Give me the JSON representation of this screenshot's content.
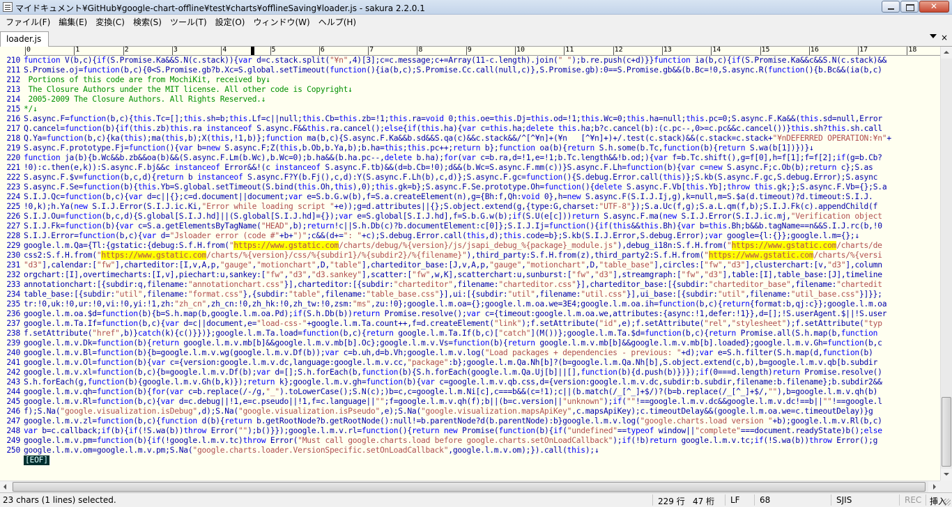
{
  "window": {
    "title": "マイドキュメント¥GitHub¥google-chart-offline¥test¥charts¥offlineSaving¥loader.js - sakura 2.2.0.1"
  },
  "menu": [
    "ファイル(F)",
    "編集(E)",
    "変換(C)",
    "検索(S)",
    "ツール(T)",
    "設定(O)",
    "ウィンドウ(W)",
    "ヘルプ(H)"
  ],
  "tab": {
    "label": "loader.js",
    "close": "×"
  },
  "ruler": [
    "0",
    "1",
    "2",
    "3",
    "4",
    "5",
    "6",
    "7",
    "8",
    "9",
    "10",
    "11",
    "12",
    "13",
    "14",
    "15",
    "16",
    "17",
    "18"
  ],
  "lines": [
    {
      "n": "210",
      "t": "function V(b,c){if(S.Promise.Ka&&S.N(c.stack)){var d=c.stack.split(\"¥n\",4)[3];c=c.message;c+=Array(11-c.length).join(\" \");b.re.push(c+d)}}function ia(b,c){if(S.Promise.Ka&&c&&S.N(c.stack)&&"
    },
    {
      "n": "211",
      "t": "S.Promise.oj=function(b,c){0<S.Promise.gb?b.Xc=S.global.setTimeout(function(){ia(b,c);S.Promise.Cc.call(null,c)},S.Promise.gb):0==S.Promise.gb&&(b.Bc=!0,S.async.R(function(){b.Bc&&(ia(b,c)"
    },
    {
      "n": "212",
      "t": " Portions of this code are from MochiKit, received by↓",
      "c": "cm"
    },
    {
      "n": "213",
      "t": " The Closure Authors under the MIT license. All other code is Copyright↓",
      "c": "cm"
    },
    {
      "n": "214",
      "t": " 2005-2009 The Closure Authors. All Rights Reserved.↓",
      "c": "cm"
    },
    {
      "n": "215",
      "t": "*/↓",
      "c": "cm"
    },
    {
      "n": "216",
      "t": "S.async.F=function(b,c){this.Tc=[];this.sh=b;this.Lf=c||null;this.Cb=this.zb=!1;this.ra=void 0;this.oe=this.Dj=this.od=!1;this.Wc=0;this.ha=null;this.pc=0;S.async.F.Ka&&(this.sd=null,Error"
    },
    {
      "n": "217",
      "t": "Q.cancel=function(b){if(this.zb)this.ra instanceof S.async.F&&this.ra.cancel();else{if(this.ha){var c=this.ha;delete this.ha;b?c.cancel(b):(c.pc--,0>=c.pc&&c.cancel())}this.sh?this.sh.call"
    },
    {
      "n": "218",
      "t": "Q.Ya=function(b,c){ka(this);ma(this,b);X(this,!1,b)};function ma(b,c){S.async.F.Ka&&b.sd&&S.qa(c)&&c.stack&&/^[^¥n]+(¥n   [^¥n]+)+/.test(c.stack)&&(c.stack=c.stack+\"¥nDEFERRED OPERATION:¥n\"+"
    },
    {
      "n": "219",
      "t": "S.async.F.prototype.Fj=function(){var b=new S.async.F;Z(this,b.Ob,b.Ya,b);b.ha=this;this.pc++;return b};function oa(b){return S.h.some(b.Tc,function(b){return S.wa(b[1])})}↓"
    },
    {
      "n": "220",
      "t": "function ja(b){b.Wc&&b.zb&&oa(b)&&(S.async.F.Lm(b.Wc),b.Wc=0);b.ha&&(b.ha.pc--,delete b.ha);for(var c=b.ra,d=!1,e=!1;b.Tc.length&&!b.od;){var f=b.Tc.shift(),g=f[0],h=f[1];f=f[2];if(g=b.Cb?"
    },
    {
      "n": "221",
      "t": "!0):c.then(e,k)):S.async.F.bj&&c instanceof Error&&!(c instanceof S.async.F.tb)&&(d=b.Cb=!0);d&&(b.Wc=S.async.F.mm(c))}S.async.F.Lh=function(b){var c=new S.async.F;c.Ob(b);return c};S.as"
    },
    {
      "n": "222",
      "t": "S.async.F.$v=function(b,c,d){return b instanceof S.async.F?Y(b.Fj(),c,d):Y(S.async.F.Lh(b),c,d)};S.async.F.gc=function(){S.debug.Error.call(this)};S.kb(S.async.F.gc,S.debug.Error);S.async"
    },
    {
      "n": "223",
      "t": "S.async.F.Se=function(b){this.Yb=S.global.setTimeout(S.bind(this.Oh,this),0);this.gk=b};S.async.F.Se.prototype.Oh=function(){delete S.async.F.Vb[this.Yb];throw this.gk;};S.async.F.Vb={};S.a"
    },
    {
      "n": "224",
      "t": "S.I.J.Qc=function(b,c){var d=c||{};c=d.document||document;var e=S.b.G.w(b),f=S.a.createElement(n),g={Bh:f,Qh:void 0},h=new S.async.F(S.I.J.Ij,g),k=null,m=S.$a(d.timeout)?d.timeout:S.I.J."
    },
    {
      "n": "225",
      "t": "!0,k);h.Ya(new S.I.J.Error(S.I.J.ic.Ki,\"Error while loading script \"+e));g=d.attributes||{};S.object.extend(g,{type:G,charset:\"UTF-8\"});S.a.Uc(f,g);S.a.L.qm(f,b);S.I.J.Fk(c).appendChild(f"
    },
    {
      "n": "226",
      "t": "S.I.J.Ou=function(b,c,d){S.global[S.I.J.hd]||(S.global[S.I.J.hd]={});var e=S.global[S.I.J.hd],f=S.b.G.w(b);if(S.U(e[c]))return S.async.F.ma(new S.I.J.Error(S.I.J.ic.mj,\"Verification object"
    },
    {
      "n": "227",
      "t": "S.I.J.Fk=function(b){var c=S.a.getElementsByTagName(\"HEAD\",b);return!c||S.h.Db(c)?b.documentElement:c[0]};S.I.J.Ij=function(){if(this&&this.Bh){var b=this.Bh;b&&b.tagName==n&&S.I.J.rc(b,!0"
    },
    {
      "n": "228",
      "t": "S.I.J.Error=function(b,c){var d=\"Jsloader error (code #\"+b+\")\";c&&(d+=\": \"+c);S.debug.Error.call(this,d);this.code=b};S.kb(S.I.J.Error,S.debug.Error);var google={l:{}};google.l.m={};↓"
    },
    {
      "n": "229",
      "t": "google.l.m.Qa={Tl:{gstatic:{debug:S.f.H.from(\"https://www.gstatic.com/charts/debug/%{version}/js/jsapi_debug_%{package}_module.js\"),debug_i18n:S.f.H.from(\"https://www.gstatic.com/charts/de"
    },
    {
      "n": "230",
      "t": "css2:S.f.H.from(\"https://www.gstatic.com/charts/%{version}/css/%{subdir1}/%{subdir2}/%{filename}\"),third_party:S.f.H.from(z),third_party2:S.f.H.from(\"https://www.gstatic.com/charts/%{versi"
    },
    {
      "n": "231",
      "t": "\"d3\"],calendar:[\"fw\"],charteditor:[I,v,A,p,\"gauge\",\"motionchart\",D,\"table\"],charteditor_base:[J,v,A,p,\"gauge\",\"motionchart\",D,\"table_base\"],circles:[\"fw\",\"d3\"],clusterchart:[v,\"d3\"],column"
    },
    {
      "n": "232",
      "t": "orgchart:[I],overtimecharts:[I,v],piechart:u,sankey:[\"fw\",\"d3\",\"d3.sankey\"],scatter:[\"fw\",w,K],scatterchart:u,sunburst:[\"fw\",\"d3\"],streamgraph:[\"fw\",\"d3\"],table:[I],table_base:[J],timeline"
    },
    {
      "n": "233",
      "t": "annotationchart:[{subdir:q,filename:\"annotationchart.css\"}],charteditor:[{subdir:\"charteditor\",filename:\"charteditor.css\"}],charteditor_base:[{subdir:\"charteditor_base\",filename:\"chartedit"
    },
    {
      "n": "234",
      "t": "table_base:[{subdir:\"util\",filename:\"format.css\"},{subdir:\"table\",filename:\"table_base.css\"}],ui:[{subdir:\"util\",filename:\"util.css\"}],ui_base:[{subdir:\"util\",filename:\"util_base.css\"}]}};"
    },
    {
      "n": "235",
      "t": "tr:!0,uk:!0,ur:!0,vi:!0,yi:!1,zh:\"zh_cn\",zh_cn:!0,zh_hk:!0,zh_tw:!0,zsm:\"ms\",zu:!0};google.l.m.oa={};google.l.m.oa.we=3E4;google.l.m.oa.ih=function(b,c){return{format:b,qj:c}};google.l.m.oa"
    },
    {
      "n": "236",
      "t": "google.l.m.oa.$d=function(b){b=S.h.map(b,google.l.m.oa.Pd);if(S.h.Db(b))return Promise.resolve();var c={timeout:google.l.m.oa.we,attributes:{async:!1,defer:!1}},d=[];!S.userAgent.$||!S.user"
    },
    {
      "n": "237",
      "t": "google.l.m.Ta.If=function(b,c){var d=c||document,e=\"load-css-\"+google.l.m.Ta.count++,f=d.createElement(\"link\");f.setAttribute(\"id\",e);f.setAttribute(\"rel\",\"stylesheet\");f.setAttribute(\"typ"
    },
    {
      "n": "238",
      "t": "f.setAttribute(\"href\",b)}catch(k){c()}})};google.l.m.Ta.load=function(b,c){return google.l.m.Ta.If(b,c)[\"catch\"](M())};google.l.m.Ta.$d=function(b,c){return Promise.all(S.h.map(b,function"
    },
    {
      "n": "239",
      "t": "google.l.m.v.Dk=function(b){return google.l.m.v.mb[b]&&google.l.m.v.mb[b].Oc};google.l.m.v.Vs=function(b){return google.l.m.v.mb[b]&&google.l.m.v.mb[b].loaded};google.l.m.v.Gh=function(b,c"
    },
    {
      "n": "240",
      "t": "google.l.m.v.Bl=function(b){b=google.l.m.v.wg(google.l.m.v.Df(b));var c=b.uh,d=b.Vh;google.l.m.v.log(\"Load packages + dependencies - previous: \"+d);var e=S.h.filter(S.h.map(d,function(b)"
    },
    {
      "n": "241",
      "t": "google.l.m.v.Ol=function(b){var c={version:google.l.m.v.dc,language:google.l.m.v.cc,\"package\":b};google.l.m.Qa.Nh[b]?(b=google.l.m.Qa.Nh[b],S.object.extend(c,b),b=google.l.m.v.qb[b.subdir"
    },
    {
      "n": "242",
      "t": "google.l.m.v.xl=function(b,c){b=google.l.m.v.Df(b);var d=[];S.h.forEach(b,function(b){S.h.forEach(google.l.m.Qa.Uj[b]||[],function(b){d.push(b)})});if(0===d.length)return Promise.resolve()"
    },
    {
      "n": "243",
      "t": "S.h.forEach(g,function(b){google.l.m.v.Gh(b,k)});return k};google.l.m.v.gh=function(b){var c=google.l.m.v.qb.css,d={version:google.l.m.v.dc,subdir:b.subdir,filename:b.filename};b.subdir2&&"
    },
    {
      "n": "244",
      "t": "google.l.m.v.qh=function(b){for(var c=b.replace(/-/g,\"_\").toLowerCase();S.N(c);)b=c,c=google.l.m.Ni[c],c===b&&(c=!1);c||(b.match(/_[^_]+$/)?(b=b.replace(/_[^_]+$/,\"\"),b=google.l.m.v.qh(b)"
    },
    {
      "n": "245",
      "t": "google.l.m.v.Rl=function(b,c){var d=c.debug||!1,e=c.pseudo||!1,f=c.language||\"\";f=google.l.m.v.qh(f);b||(b=c.version||\"unknown\");if(\"\"!==google.l.m.v.dc&&google.l.m.v.dc!==b||\"\"!==google.l"
    },
    {
      "n": "246",
      "t": "f);S.Na(\"google.visualization.isDebug\",d);S.Na(\"google.visualization.isPseudo\",e);S.Na(\"google.visualization.mapsApiKey\",c.mapsApiKey);c.timeoutDelay&&(google.l.m.oa.we=c.timeoutDelay)}g"
    },
    {
      "n": "247",
      "t": "google.l.m.v.zl=function(b,c){function d(b){return b.getRootNode?b.getRootNode():null!=b.parentNode?d(b.parentNode):b}google.l.m.v.log(\"google.charts.load version \"+b);google.l.m.v.Rl(b,c)"
    },
    {
      "n": "248",
      "t": "var b=c.callback;if(b){if(!S.wa(b))throw Error(\"\");b()}});google.l.m.v.rl=function(){return new Promise(function(b){if(\"undefined\"==typeof window||\"complete\"===document.readyState)b();else"
    },
    {
      "n": "249",
      "t": "google.l.m.v.pm=function(b){if(!google.l.m.v.tc)throw Error(\"Must call google.charts.load before google.charts.setOnLoadCallback\");if(!b)return google.l.m.v.tc;if(!S.wa(b))throw Error();g"
    },
    {
      "n": "250",
      "t": "google.l.m.v.om=google.l.m.v.pm;S.Na(\"google.charts.loader.VersionSpecific.setOnLoadCallback\",google.l.m.v.om);}).call(this);↓"
    }
  ],
  "highlight": "https://www.gstatic.com",
  "eof": "[EOF]",
  "status": {
    "selection": "23 chars (1 lines) selected.",
    "row": "229 行",
    "col": "47 桁",
    "eol": "LF",
    "code": "68",
    "encoding": "SJIS",
    "rec": "REC",
    "mode": "挿入"
  }
}
